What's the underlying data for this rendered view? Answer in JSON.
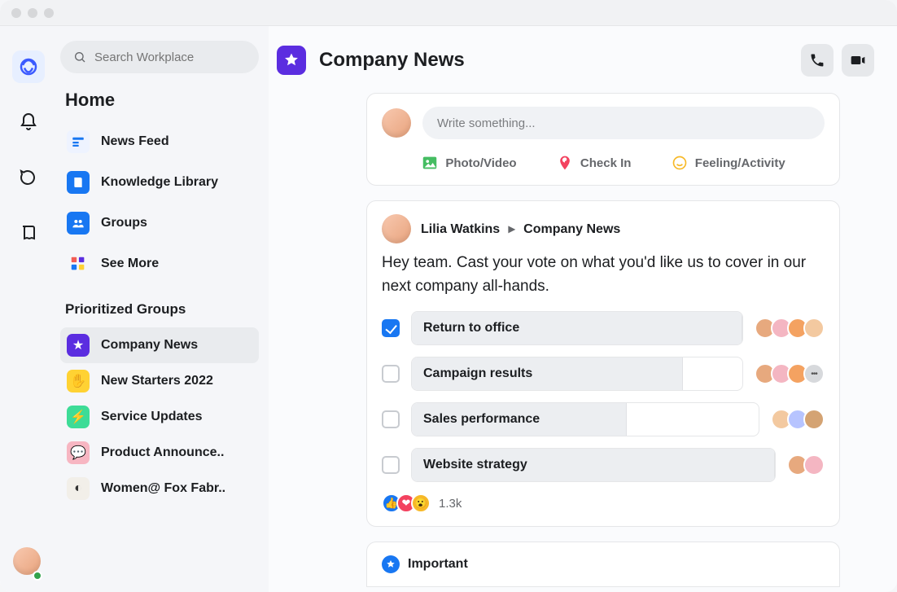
{
  "search": {
    "placeholder": "Search Workplace"
  },
  "sidebar": {
    "home_title": "Home",
    "nav": [
      {
        "label": "News Feed",
        "bg": "#eef3ff",
        "stroke": "#1877f2"
      },
      {
        "label": "Knowledge Library",
        "bg": "#1877f2"
      },
      {
        "label": "Groups",
        "bg": "#1877f2"
      },
      {
        "label": "See More",
        "bg": "#ffffff"
      }
    ],
    "prioritized_title": "Prioritized Groups",
    "groups": [
      {
        "label": "Company News",
        "bg": "#5b2de0",
        "glyph": "★",
        "active": true
      },
      {
        "label": "New Starters 2022",
        "bg": "#ffd233",
        "glyph": "✋",
        "active": false
      },
      {
        "label": "Service Updates",
        "bg": "#3ddc97",
        "glyph": "⚡",
        "active": false
      },
      {
        "label": "Product Announce..",
        "bg": "#f7b6c2",
        "glyph": "💬",
        "active": false
      },
      {
        "label": "Women@ Fox Fabr..",
        "bg": "#f2efe9",
        "glyph": "◐",
        "active": false
      }
    ]
  },
  "page": {
    "title": "Company News"
  },
  "composer": {
    "placeholder": "Write something...",
    "actions": {
      "photo": "Photo/Video",
      "checkin": "Check In",
      "feeling": "Feeling/Activity"
    }
  },
  "post": {
    "author": "Lilia Watkins",
    "group": "Company News",
    "body": "Hey team. Cast your vote on what you'd like us to cover in our next company all-hands.",
    "poll": [
      {
        "label": "Return to office",
        "checked": true,
        "fill": 100,
        "voters": 4,
        "voters_more": false
      },
      {
        "label": "Campaign results",
        "checked": false,
        "fill": 82,
        "voters": 4,
        "voters_more": true
      },
      {
        "label": "Sales performance",
        "checked": false,
        "fill": 62,
        "voters": 3,
        "voters_more": false
      },
      {
        "label": "Website strategy",
        "checked": false,
        "fill": 100,
        "voters": 2,
        "voters_more": false
      }
    ],
    "reaction_count": "1.3k"
  },
  "important": {
    "label": "Important"
  },
  "colors": {
    "voter_palette": [
      "#e7a97e",
      "#f3c9a0",
      "#7fb77e",
      "#f4b6c2",
      "#b7c4ff",
      "#c3e3d4",
      "#f4a261",
      "#d4a373"
    ]
  }
}
